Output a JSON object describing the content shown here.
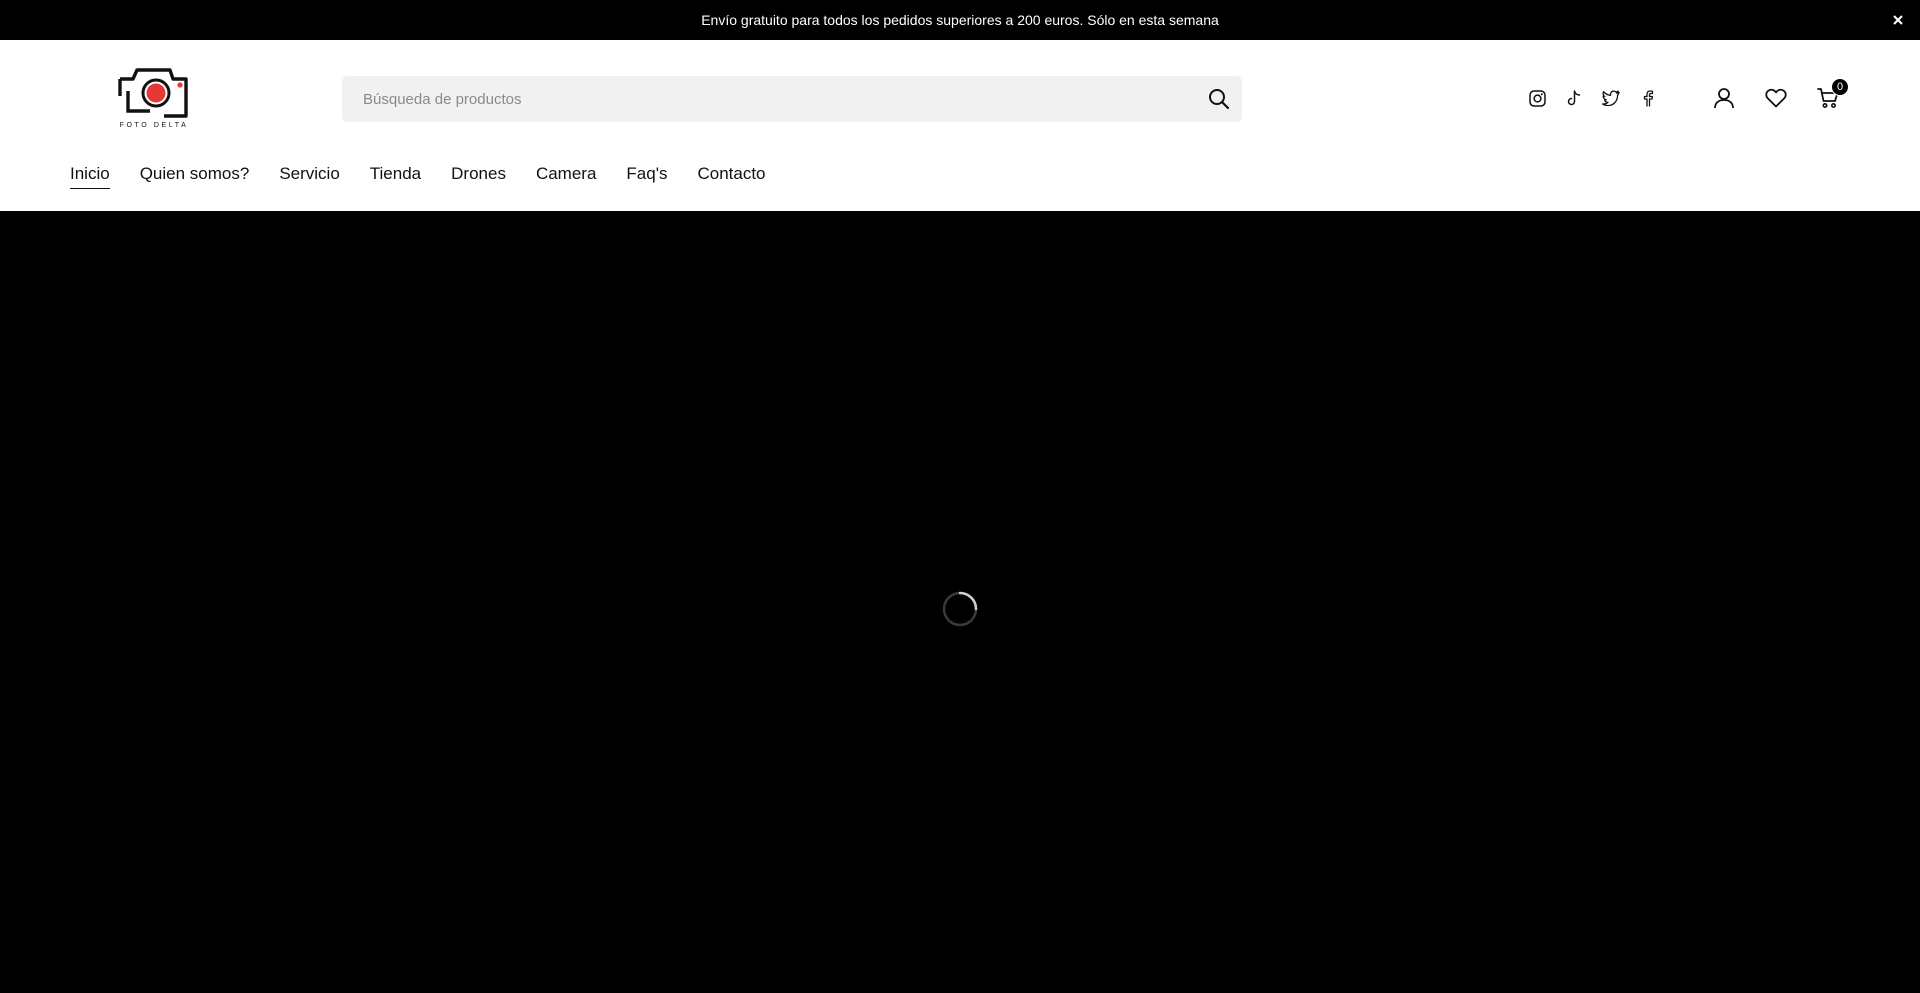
{
  "announcement": {
    "text": "Envío gratuito para todos los pedidos superiores a 200 euros. Sólo en esta semana",
    "close_label": "×"
  },
  "brand": {
    "name": "FOTO DELTA",
    "accent_color": "#e53935"
  },
  "search": {
    "placeholder": "Búsqueda de productos",
    "value": ""
  },
  "socials": [
    "instagram-icon",
    "tiktok-icon",
    "twitter-icon",
    "facebook-icon"
  ],
  "actions": {
    "cart_count": "0"
  },
  "nav": {
    "items": [
      {
        "label": "Inicio",
        "active": true
      },
      {
        "label": "Quien somos?"
      },
      {
        "label": "Servicio"
      },
      {
        "label": "Tienda"
      },
      {
        "label": "Drones"
      },
      {
        "label": "Camera"
      },
      {
        "label": "Faq's"
      },
      {
        "label": "Contacto"
      }
    ]
  },
  "hero": {
    "state": "loading",
    "background": "#000000"
  }
}
